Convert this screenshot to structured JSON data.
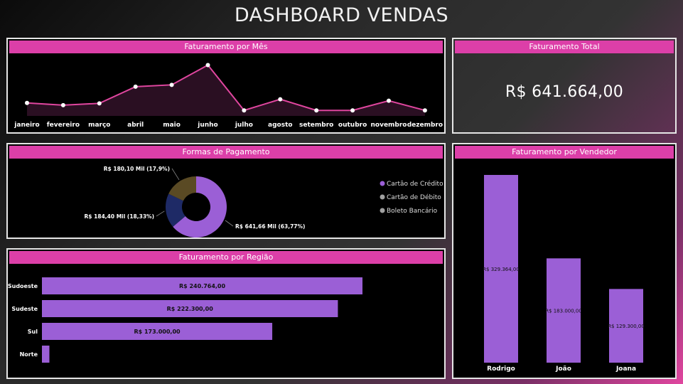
{
  "header": {
    "title": "DASHBOARD VENDAS"
  },
  "colors": {
    "accent": "#dc3fa8",
    "bar": "#9b5fd6",
    "line": "#e0469f"
  },
  "panels": {
    "mes": "Faturamento por Mês",
    "total": "Faturamento Total",
    "pagamento": "Formas de Pagamento",
    "regiao": "Faturamento por Região",
    "vendedor": "Faturamento por Vendedor"
  },
  "total": {
    "value": "R$ 641.664,00"
  },
  "chart_data": [
    {
      "type": "area",
      "title": "Faturamento por Mês",
      "categories": [
        "janeiro",
        "fevereiro",
        "março",
        "abril",
        "maio",
        "junho",
        "julho",
        "agosto",
        "setembro",
        "outubro",
        "novembro",
        "dezembro"
      ],
      "values": [
        70000,
        58000,
        68000,
        158000,
        168000,
        275000,
        30000,
        90000,
        30000,
        30000,
        82000,
        30000
      ],
      "ylim": [
        0,
        300000
      ]
    },
    {
      "type": "pie",
      "title": "Formas de Pagamento",
      "donut": true,
      "slices": [
        {
          "name": "Cartão de Crédito",
          "value": 641.66,
          "percent": 63.77,
          "label": "R$ 641,66 Mil (63,77%)",
          "color": "#9b5fd6"
        },
        {
          "name": "Cartão de Débito",
          "value": 184.4,
          "percent": 18.33,
          "label": "R$ 184,40 Mil (18,33%)",
          "color": "#1e2a66"
        },
        {
          "name": "Boleto Bancário",
          "value": 180.1,
          "percent": 17.9,
          "label": "R$ 180,10 Mil (17,9%)",
          "color": "#5a4a24"
        }
      ],
      "legend": [
        "Cartão de Crédito",
        "Cartão de Débito",
        "Boleto Bancário"
      ],
      "legend_colors": [
        "#9b5fd6",
        "#a0a0a0",
        "#a0a0a0"
      ],
      "legend_position": "right"
    },
    {
      "type": "bar",
      "orientation": "horizontal",
      "title": "Faturamento por Região",
      "categories": [
        "Sudoeste",
        "Sudeste",
        "Sul",
        "Norte"
      ],
      "values": [
        240764,
        222300,
        173000,
        5600
      ],
      "labels": [
        "R$ 240.764,00",
        "R$ 222.300,00",
        "R$ 173.000,00",
        ""
      ]
    },
    {
      "type": "bar",
      "title": "Faturamento por Vendedor",
      "categories": [
        "Rodrigo",
        "João",
        "Joana"
      ],
      "values": [
        329364,
        183000,
        129300
      ],
      "labels": [
        "R$ 329.364,00",
        "R$ 183.000,00",
        "R$ 129.300,00"
      ]
    }
  ]
}
